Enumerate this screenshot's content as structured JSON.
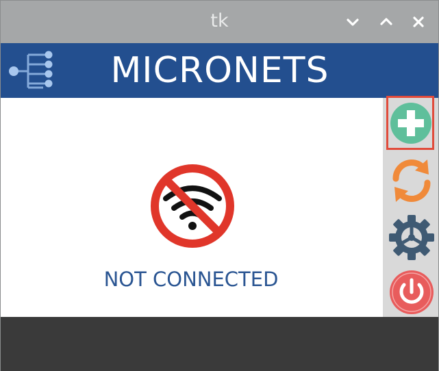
{
  "window": {
    "title": "tk",
    "controls": [
      "minimize",
      "maximize",
      "close"
    ]
  },
  "header": {
    "app_title": "MICRONETS",
    "logo_icon": "network-tree-icon",
    "background": "#234f8f"
  },
  "main": {
    "status_icon": "wifi-off-icon",
    "status_text": "NOT CONNECTED",
    "status_color": "#2a5592"
  },
  "sidebar": {
    "buttons": [
      {
        "name": "add",
        "icon": "plus-icon",
        "color": "#5fbf9b",
        "selected": true
      },
      {
        "name": "refresh",
        "icon": "refresh-icon",
        "color": "#f08a3a"
      },
      {
        "name": "settings",
        "icon": "gear-icon",
        "color": "#3f5a73"
      },
      {
        "name": "power",
        "icon": "power-icon",
        "color": "#e85c5c"
      }
    ]
  }
}
